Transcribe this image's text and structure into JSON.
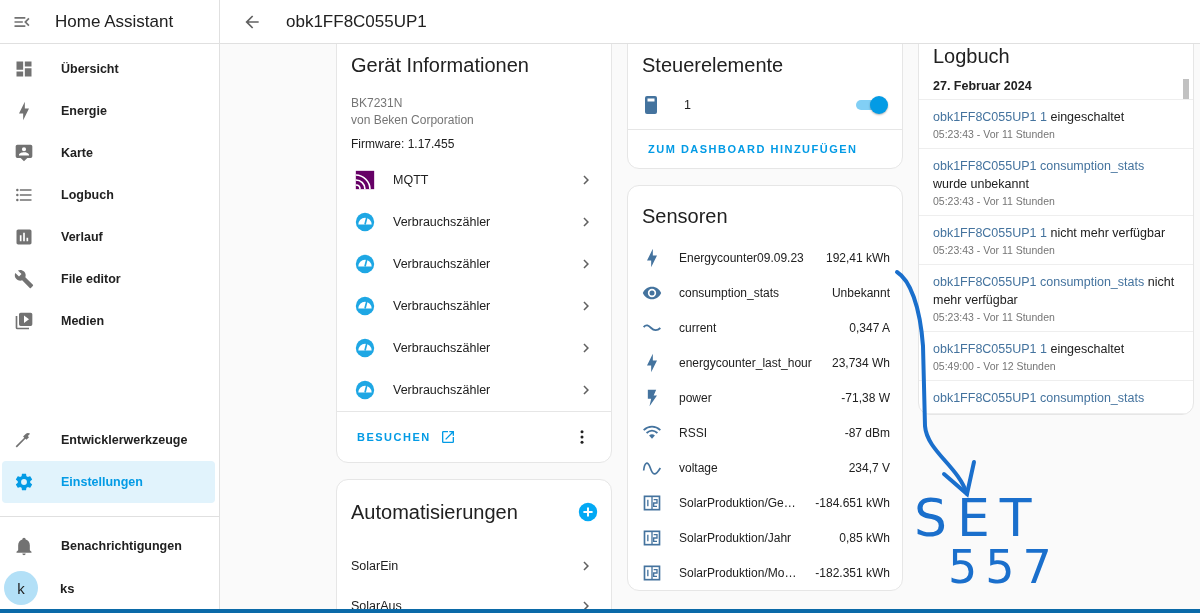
{
  "sidebar": {
    "title": "Home Assistant",
    "items": [
      {
        "label": "Übersicht",
        "selected": false
      },
      {
        "label": "Energie",
        "selected": false
      },
      {
        "label": "Karte",
        "selected": false
      },
      {
        "label": "Logbuch",
        "selected": false
      },
      {
        "label": "Verlauf",
        "selected": false
      },
      {
        "label": "File editor",
        "selected": false
      },
      {
        "label": "Medien",
        "selected": false
      }
    ],
    "tools": [
      {
        "label": "Entwicklerwerkzeuge",
        "selected": false
      },
      {
        "label": "Einstellungen",
        "selected": true
      }
    ],
    "notifications": "Benachrichtigungen",
    "user": {
      "initial": "k",
      "name": "ks"
    }
  },
  "header": {
    "title": "obk1FF8C055UP1"
  },
  "device_info": {
    "title": "Gerät Informationen",
    "model": "BK7231N",
    "manufacturer": "von Beken Corporation",
    "firmware": "Firmware: 1.17.455",
    "integrations": [
      {
        "kind": "mqtt",
        "label": "MQTT"
      },
      {
        "kind": "meter",
        "label": "Verbrauchszähler"
      },
      {
        "kind": "meter",
        "label": "Verbrauchszähler"
      },
      {
        "kind": "meter",
        "label": "Verbrauchszähler"
      },
      {
        "kind": "meter",
        "label": "Verbrauchszähler"
      },
      {
        "kind": "meter",
        "label": "Verbrauchszähler"
      }
    ],
    "visit": "BESUCHEN"
  },
  "automations": {
    "title": "Automatisierungen",
    "items": [
      "SolarEin",
      "SolarAus"
    ]
  },
  "controls": {
    "title": "Steuerelemente",
    "entity": {
      "name": "1",
      "on": true
    },
    "add_button": "ZUM DASHBOARD HINZUFÜGEN"
  },
  "sensors": {
    "title": "Sensoren",
    "rows": [
      {
        "name": "Energycounter09.09.23",
        "value": "192,41 kWh"
      },
      {
        "name": "consumption_stats",
        "value": "Unbekannt"
      },
      {
        "name": "current",
        "value": "0,347 A"
      },
      {
        "name": "energycounter_last_hour",
        "value": "23,734 Wh"
      },
      {
        "name": "power",
        "value": "-71,38 W"
      },
      {
        "name": "RSSI",
        "value": "-87 dBm"
      },
      {
        "name": "voltage",
        "value": "234,7 V"
      },
      {
        "name": "SolarProduktion/Ge…",
        "value": "-184.651 kWh"
      },
      {
        "name": "SolarProduktion/Jahr",
        "value": "0,85 kWh"
      },
      {
        "name": "SolarProduktion/Mo…",
        "value": "-182.351 kWh"
      }
    ]
  },
  "logbook": {
    "title": "Logbuch",
    "date": "27. Februar 2024",
    "entries": [
      {
        "entity": "obk1FF8C055UP1 1",
        "message": "eingeschaltet",
        "time": "05:23:43 - Vor 11 Stunden"
      },
      {
        "entity": "obk1FF8C055UP1 consumption_stats",
        "message": "wurde unbekannt",
        "time": "05:23:43 - Vor 11 Stunden"
      },
      {
        "entity": "obk1FF8C055UP1 1",
        "message": "nicht mehr verfügbar",
        "time": "05:23:43 - Vor 11 Stunden"
      },
      {
        "entity": "obk1FF8C055UP1 consumption_stats",
        "message": "nicht mehr verfügbar",
        "time": "05:23:43 - Vor 11 Stunden"
      },
      {
        "entity": "obk1FF8C055UP1 1",
        "message": "eingeschaltet",
        "time": "05:49:00 - Vor 12 Stunden"
      },
      {
        "entity": "obk1FF8C055UP1 consumption_stats"
      }
    ]
  },
  "annotation": {
    "lines": [
      "SET",
      "557"
    ]
  }
}
